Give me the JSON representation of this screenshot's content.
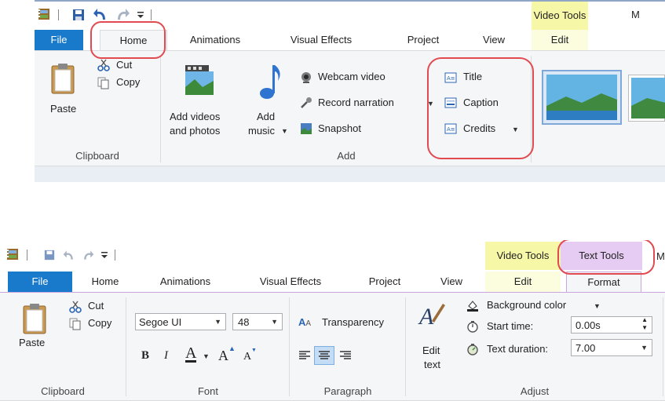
{
  "top": {
    "context_tools_label": "Video Tools",
    "context_tab_edit": "Edit",
    "title_partial": "M",
    "tabs": {
      "file": "File",
      "home": "Home",
      "animations": "Animations",
      "visual_effects": "Visual Effects",
      "project": "Project",
      "view": "View"
    },
    "clipboard": {
      "paste": "Paste",
      "cut": "Cut",
      "copy": "Copy",
      "group": "Clipboard"
    },
    "add": {
      "add_videos_line1": "Add videos",
      "add_videos_line2": "and photos",
      "add_music_line1": "Add",
      "add_music_line2": "music",
      "webcam": "Webcam video",
      "record": "Record narration",
      "snapshot": "Snapshot",
      "group": "Add",
      "title": "Title",
      "caption": "Caption",
      "credits": "Credits"
    }
  },
  "bottom": {
    "video_tools_label": "Video Tools",
    "text_tools_label": "Text Tools",
    "title_partial": "M",
    "tabs": {
      "file": "File",
      "home": "Home",
      "animations": "Animations",
      "visual_effects": "Visual Effects",
      "project": "Project",
      "view": "View",
      "edit": "Edit",
      "format": "Format"
    },
    "clipboard": {
      "paste": "Paste",
      "cut": "Cut",
      "copy": "Copy",
      "group": "Clipboard"
    },
    "font": {
      "family": "Segoe UI",
      "size": "48",
      "bold": "B",
      "italic": "I",
      "color": "A",
      "grow": "A",
      "shrink": "A",
      "group": "Font"
    },
    "paragraph": {
      "transparency": "Transparency",
      "group": "Paragraph"
    },
    "adjust": {
      "edit_text_line1": "Edit",
      "edit_text_line2": "text",
      "background_color": "Background color",
      "start_time_label": "Start time:",
      "start_time_value": "0.00s",
      "duration_label": "Text duration:",
      "duration_value": "7.00",
      "group": "Adjust"
    }
  },
  "colors": {
    "file_tab": "#1979ca",
    "video_tools": "#f7f7a8",
    "text_tools": "#e6ccf3",
    "annotation": "#e04a50"
  }
}
